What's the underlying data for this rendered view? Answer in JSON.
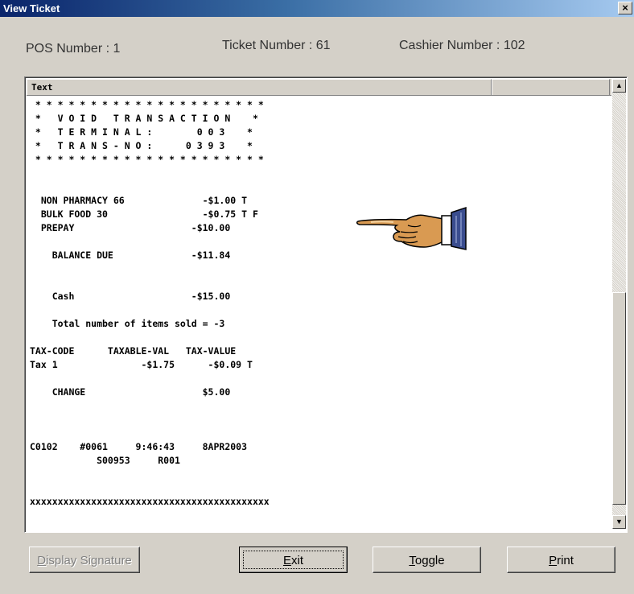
{
  "window": {
    "title": "View Ticket",
    "close_label": "×"
  },
  "header": {
    "pos": "POS Number : 1",
    "ticket": "Ticket Number : 61",
    "cashier": "Cashier Number : 102"
  },
  "list": {
    "column_text": "Text",
    "column_2": ""
  },
  "receipt_lines": [
    " * * * * * * * * * * * * * * * * * * * * *",
    " *   V O I D   T R A N S A C T I O N    *",
    " *   T E R M I N A L :        0 0 3    *",
    " *   T R A N S - N O :      0 3 9 3    *",
    " * * * * * * * * * * * * * * * * * * * * *",
    "",
    "",
    "  NON PHARMACY 66              -$1.00 T",
    "  BULK FOOD 30                 -$0.75 T F",
    "  PREPAY                     -$10.00",
    "",
    "    BALANCE DUE              -$11.84",
    "",
    "",
    "    Cash                     -$15.00",
    "",
    "    Total number of items sold = -3",
    "",
    "TAX-CODE      TAXABLE-VAL   TAX-VALUE",
    "Tax 1               -$1.75      -$0.09 T",
    "",
    "    CHANGE                     $5.00",
    "",
    "",
    "",
    "C0102    #0061     9:46:43     8APR2003",
    "            S00953     R001",
    "",
    "",
    "xxxxxxxxxxxxxxxxxxxxxxxxxxxxxxxxxxxxxxxxxxx"
  ],
  "buttons": {
    "display_signature": {
      "underline": "D",
      "rest": "isplay Signature"
    },
    "exit": {
      "underline": "E",
      "rest": "xit"
    },
    "toggle": {
      "underline": "T",
      "rest": "oggle"
    },
    "print": {
      "underline": "P",
      "rest": "rint"
    }
  },
  "icons": {
    "pointing_hand": "pointing-hand-icon",
    "scroll_up": "▲",
    "scroll_down": "▼"
  },
  "colors": {
    "titlebar_start": "#0a246a",
    "titlebar_end": "#a6caf0",
    "face": "#d4d0c8"
  }
}
